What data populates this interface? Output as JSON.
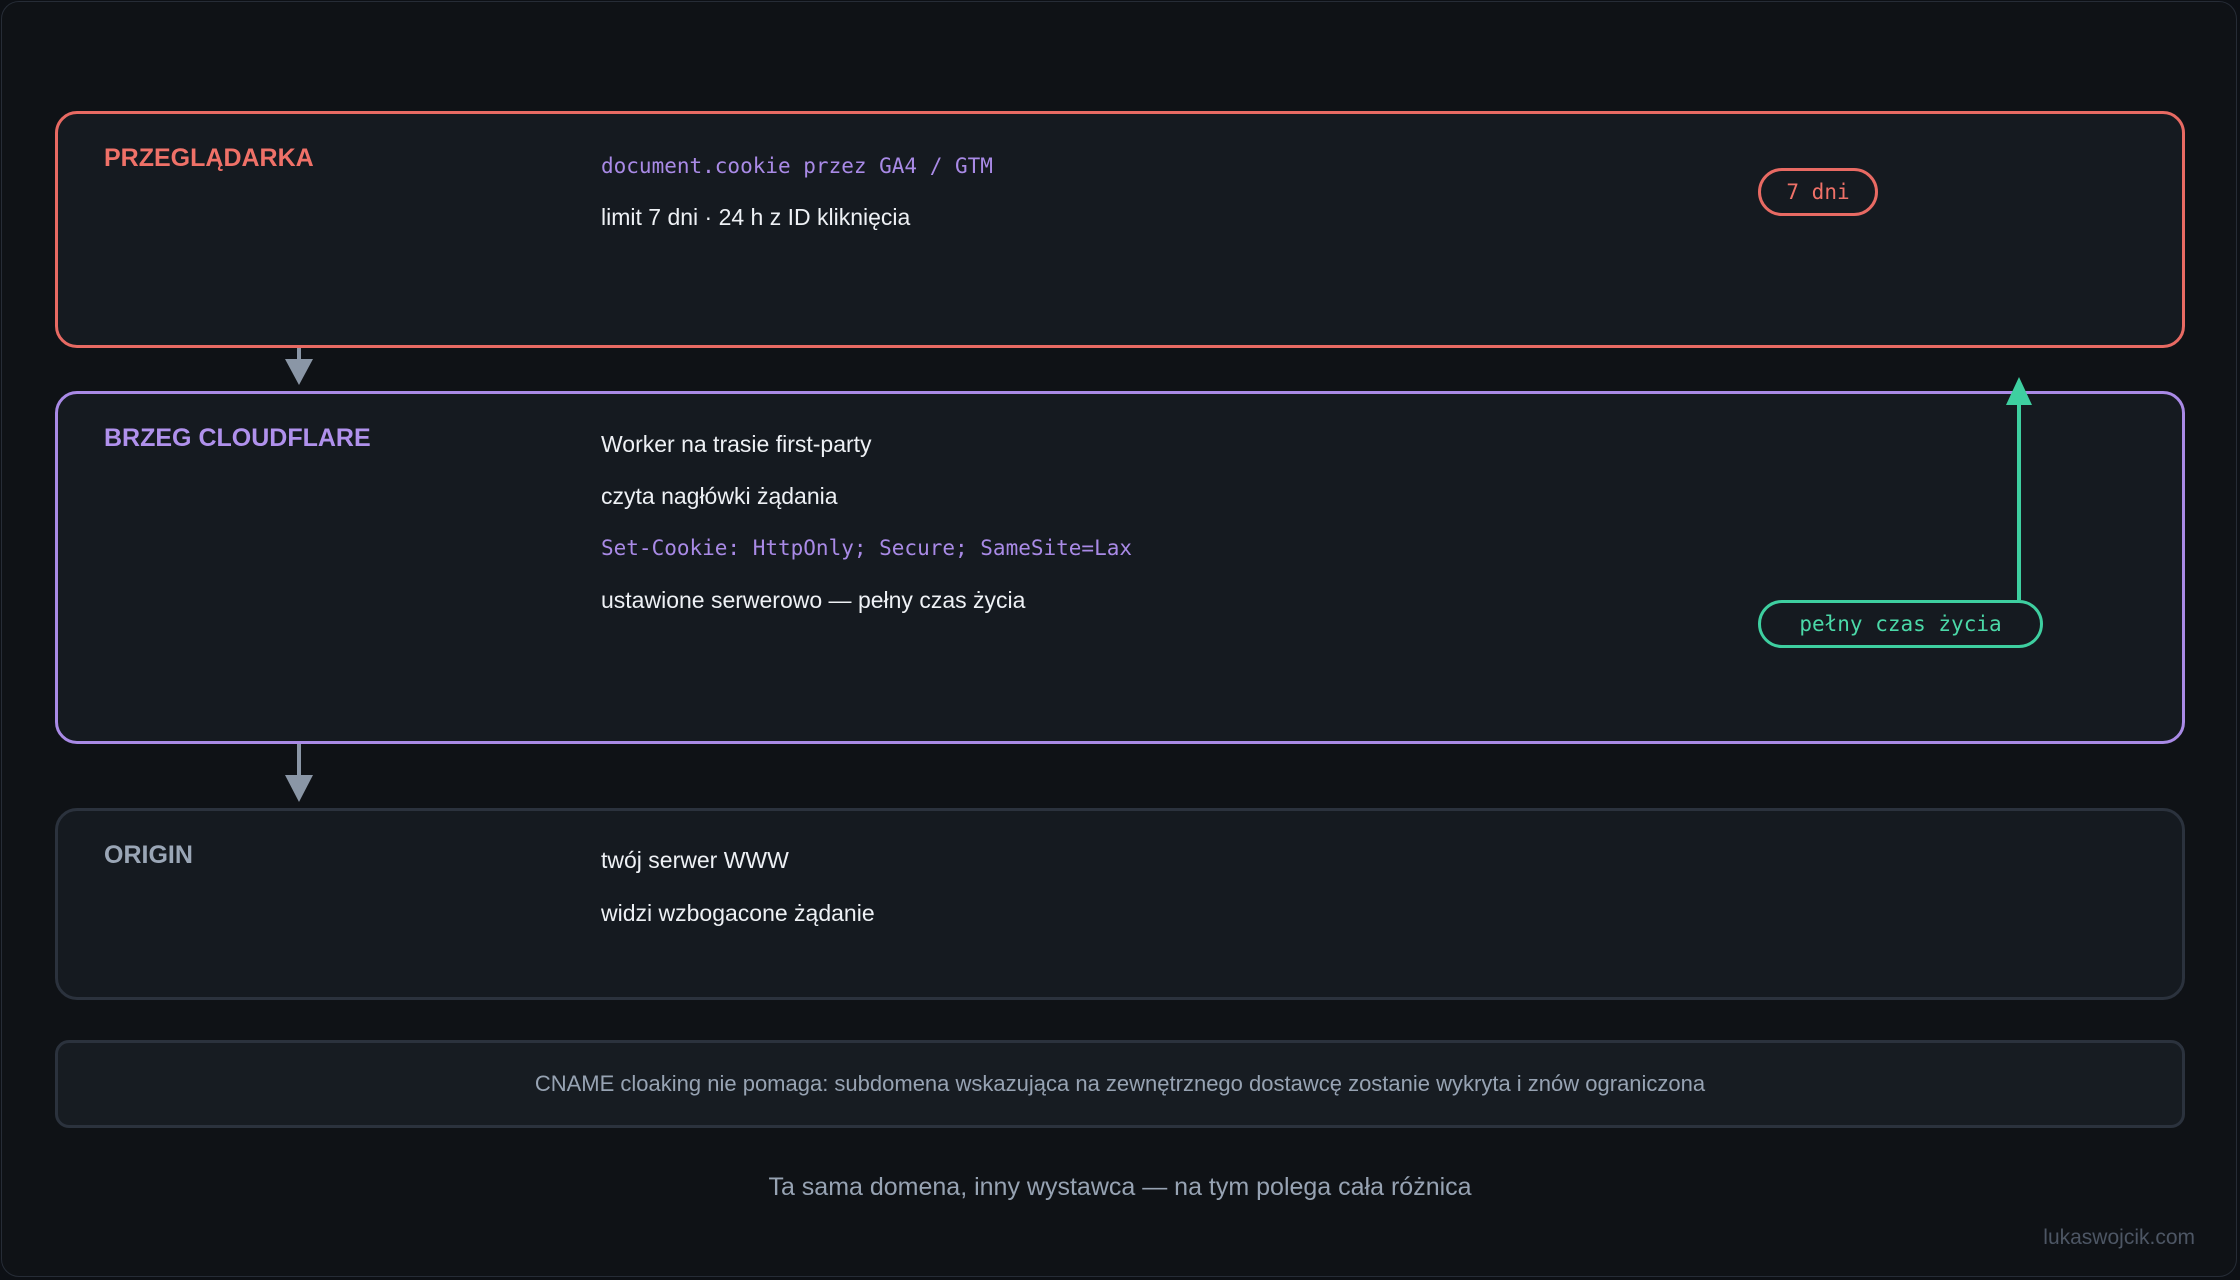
{
  "layers": {
    "browser": {
      "title": "PRZEGLĄDARKA",
      "lines": [
        "document.cookie przez GA4 / GTM",
        "limit 7 dni · 24 h z ID kliknięcia"
      ],
      "badge": "7 dni",
      "color": "#e86a63"
    },
    "edge": {
      "title": "BRZEG CLOUDFLARE",
      "lines": [
        "Worker na trasie first-party",
        "czyta nagłówki żądania",
        "Set-Cookie: HttpOnly; Secure; SameSite=Lax",
        "ustawione serwerowo — pełny czas życia"
      ],
      "badge": "pełny czas życia",
      "color": "#a98ae6"
    },
    "origin": {
      "title": "ORIGIN",
      "lines": [
        "twój serwer WWW",
        "widzi wzbogacone żądanie"
      ],
      "color": "#9aa6b6"
    }
  },
  "note": "CNAME cloaking nie pomaga: subdomena wskazująca na zewnętrznego dostawcę zostanie wykryta i znów ograniczona",
  "caption": "Ta sama domena, inny wystawca — na tym polega cała różnica",
  "credit": "lukaswojcik.com",
  "colors": {
    "accent_green": "#3ecfa0",
    "arrow_gray": "#8a96a6",
    "background": "#0f1216"
  }
}
